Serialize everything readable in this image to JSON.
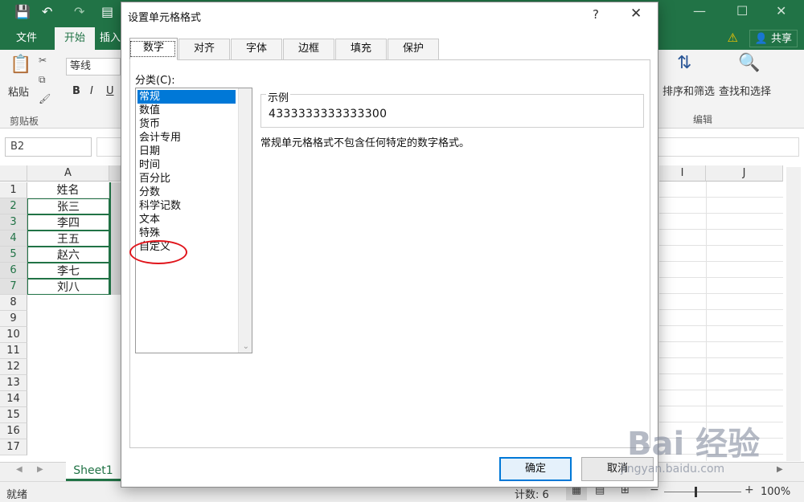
{
  "excel": {
    "ribbon_tabs": [
      "文件",
      "开始",
      "插入"
    ],
    "active_tab": "开始",
    "share_label": "共享",
    "font_name": "等线",
    "paste_label": "粘贴",
    "clipboard_group": "剪贴板",
    "sort_filter_label": "排序和筛选",
    "find_select_label": "查找和选择",
    "edit_group": "编辑",
    "name_box": "B2",
    "col_headers": [
      "A",
      "I",
      "J"
    ],
    "rows": [
      "1",
      "2",
      "3",
      "4",
      "5",
      "6",
      "7",
      "8",
      "9",
      "10",
      "11",
      "12",
      "13",
      "14",
      "15",
      "16",
      "17"
    ],
    "col_a": [
      "姓名",
      "张三",
      "李四",
      "王五",
      "赵六",
      "李七",
      "刘八"
    ],
    "sheet_tab": "Sheet1",
    "status_left": "就绪",
    "status_count": "计数: 6",
    "zoom": "100%"
  },
  "dialog": {
    "title": "设置单元格格式",
    "help": "?",
    "close": "✕",
    "tabs": [
      "数字",
      "对齐",
      "字体",
      "边框",
      "填充",
      "保护"
    ],
    "active_tab": "数字",
    "category_label": "分类(C):",
    "categories": [
      "常规",
      "数值",
      "货币",
      "会计专用",
      "日期",
      "时间",
      "百分比",
      "分数",
      "科学记数",
      "文本",
      "特殊",
      "自定义"
    ],
    "selected_category": "常规",
    "sample_label": "示例",
    "sample_value": "4333333333333300",
    "description": "常规单元格格式不包含任何特定的数字格式。",
    "ok_label": "确定",
    "cancel_label": "取消"
  },
  "watermark": {
    "brand": "Bai 经验",
    "url": "jingyan.baidu.com"
  },
  "colors": {
    "excel_green": "#217346",
    "selection_blue": "#0078d7",
    "annotation_red": "#e0141b"
  }
}
